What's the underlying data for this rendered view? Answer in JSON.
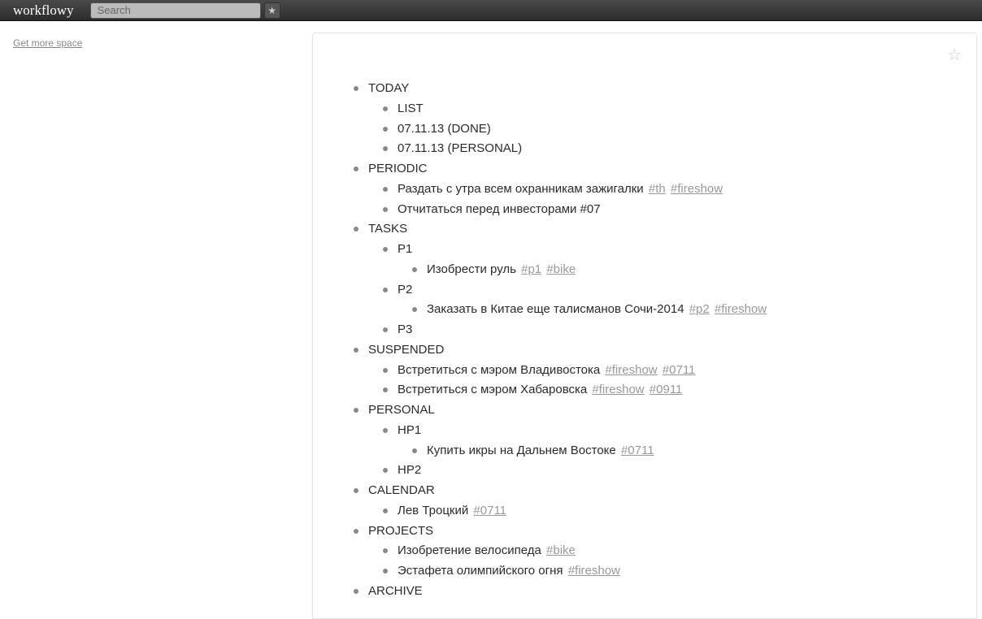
{
  "header": {
    "logo": "workflowy",
    "search_placeholder": "Search",
    "star_icon": "★"
  },
  "sidebar": {
    "get_more_space": "Get more space"
  },
  "star_outline": "☆",
  "outline": [
    {
      "text": "TODAY",
      "children": [
        {
          "text": "LIST"
        },
        {
          "text": "07.11.13 (DONE)"
        },
        {
          "text": "07.11.13 (PERSONAL)"
        }
      ]
    },
    {
      "text": "PERIODIC",
      "children": [
        {
          "text": "Раздать с утра всем охранникам зажигалки",
          "tags": [
            "#th",
            "#fireshow"
          ]
        },
        {
          "text": "Отчитаться перед инвесторами #07"
        }
      ]
    },
    {
      "text": "TASKS",
      "children": [
        {
          "text": "P1",
          "children": [
            {
              "text": "Изобрести руль",
              "tags": [
                "#p1",
                "#bike"
              ]
            }
          ]
        },
        {
          "text": "P2",
          "children": [
            {
              "text": "Заказать в Китае еще талисманов Сочи-2014",
              "tags": [
                "#p2",
                "#fireshow"
              ]
            }
          ]
        },
        {
          "text": "P3"
        }
      ]
    },
    {
      "text": "SUSPENDED",
      "children": [
        {
          "text": "Встретиться с мэром Владивостока",
          "tags": [
            "#fireshow",
            "#0711"
          ]
        },
        {
          "text": "Встретиться с мэром Хабаровска",
          "tags": [
            "#fireshow",
            "#0911"
          ]
        }
      ]
    },
    {
      "text": "PERSONAL",
      "children": [
        {
          "text": "HP1",
          "children": [
            {
              "text": "Купить икры на Дальнем Востоке",
              "tags": [
                "#0711"
              ]
            }
          ]
        },
        {
          "text": "HP2"
        }
      ]
    },
    {
      "text": "CALENDAR",
      "children": [
        {
          "text": "Лев Троцкий",
          "tags": [
            "#0711"
          ]
        }
      ]
    },
    {
      "text": "PROJECTS",
      "children": [
        {
          "text": "Изобретение велосипеда",
          "tags": [
            "#bike"
          ]
        },
        {
          "text": "Эстафета олимпийского огня",
          "tags": [
            "#fireshow"
          ]
        }
      ]
    },
    {
      "text": "ARCHIVE"
    }
  ]
}
